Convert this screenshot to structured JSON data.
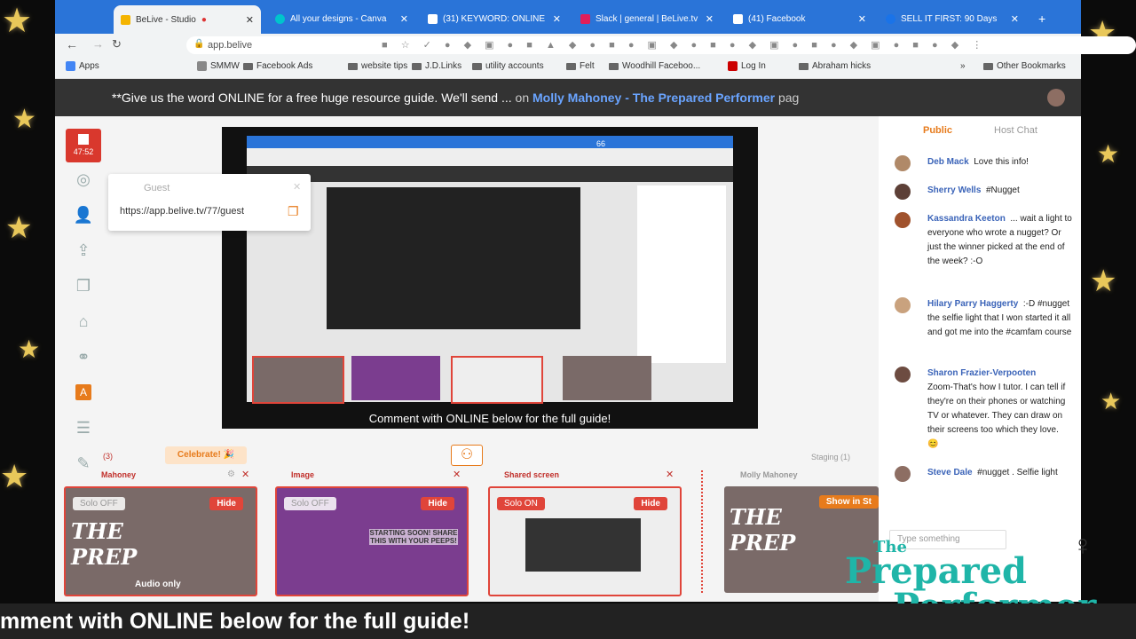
{
  "browser": {
    "tabs": [
      {
        "title": "BeLive - Studio",
        "active": true,
        "color": "#f4b400"
      },
      {
        "title": "All your designs - Canva",
        "color": "#00c4cc"
      },
      {
        "title": "(31) KEYWORD: ONLINE",
        "color": "#1a73e8"
      },
      {
        "title": "Slack | general | BeLive.tv",
        "color": "#611f69"
      },
      {
        "title": "(41) Facebook",
        "color": "#1877f2"
      },
      {
        "title": "SELL IT FIRST: 90 Days",
        "color": "#888"
      }
    ],
    "new_tab": "+",
    "url": "app.belive",
    "bookmarks": [
      "Apps",
      "SMMW",
      "Facebook Ads",
      "website tips",
      "J.D.Links",
      "utility accounts",
      "Felt",
      "Woodhill Faceboo...",
      "Log In",
      "Abraham hicks",
      "Other Bookmarks"
    ],
    "more": "»"
  },
  "banner": {
    "text": "**Give us the word ONLINE for a free huge resource guide. We'll send ...",
    "on": "on",
    "source": "Molly Mahoney - The Prepared Performer",
    "suffix": "pag"
  },
  "recorder": {
    "timer": "47:52"
  },
  "guest_popup": {
    "title": "Guest",
    "link": "https://app.belive.tv/77/guest"
  },
  "preview": {
    "caption": "Comment with ONLINE below for the full guide!",
    "reactions": "66"
  },
  "strip": {
    "celebrate": "Celebrate! 🎉",
    "staging": "Staging (1)",
    "count": "(3)",
    "cards": [
      {
        "label": "Mahoney",
        "solo": "Solo OFF",
        "hide": "Hide",
        "footer": "Audio only"
      },
      {
        "label": "Image",
        "solo": "Solo OFF",
        "hide": "Hide",
        "footer": "STARTING SOON! SHARE THIS WITH YOUR PEEPS!"
      },
      {
        "label": "Shared screen",
        "solo": "Solo ON",
        "hide": "Hide",
        "footer": ""
      },
      {
        "label": "Molly Mahoney",
        "show": "Show in St",
        "footer": ""
      }
    ]
  },
  "chat": {
    "tab_public": "Public",
    "tab_host": "Host Chat",
    "messages": [
      {
        "name": "Deb Mack",
        "text": "Love this info!"
      },
      {
        "name": "Sherry Wells",
        "text": "#Nugget"
      },
      {
        "name": "Kassandra Keeton",
        "text": "... wait a light to everyone who wrote a nugget? Or just the winner picked at the end of the week? :-O"
      },
      {
        "name": "Hilary Parry Haggerty",
        "text": ":-D #nugget the selfie light that I won started it all and got me into the #camfam course"
      },
      {
        "name": "Sharon Frazier-Verpooten",
        "text": "Zoom-That's how I tutor. I can tell if they're on their phones or watching TV or whatever. They can draw on their screens too which they love. 😊"
      },
      {
        "name": "Steve Dale",
        "text": "#nugget . Selfie light"
      }
    ],
    "input_placeholder": "Type something"
  },
  "logo": {
    "line1": "The",
    "line2": "Prepared",
    "line3": "Performer"
  },
  "bottom_caption": "mment with ONLINE below for the full guide!",
  "colors": {
    "accent_red": "#d9382d",
    "link_blue": "#3a63b8",
    "chrome_blue": "#2a74d8",
    "logo_teal": "#1fb5a8",
    "star_gold": "#e9c85a"
  }
}
